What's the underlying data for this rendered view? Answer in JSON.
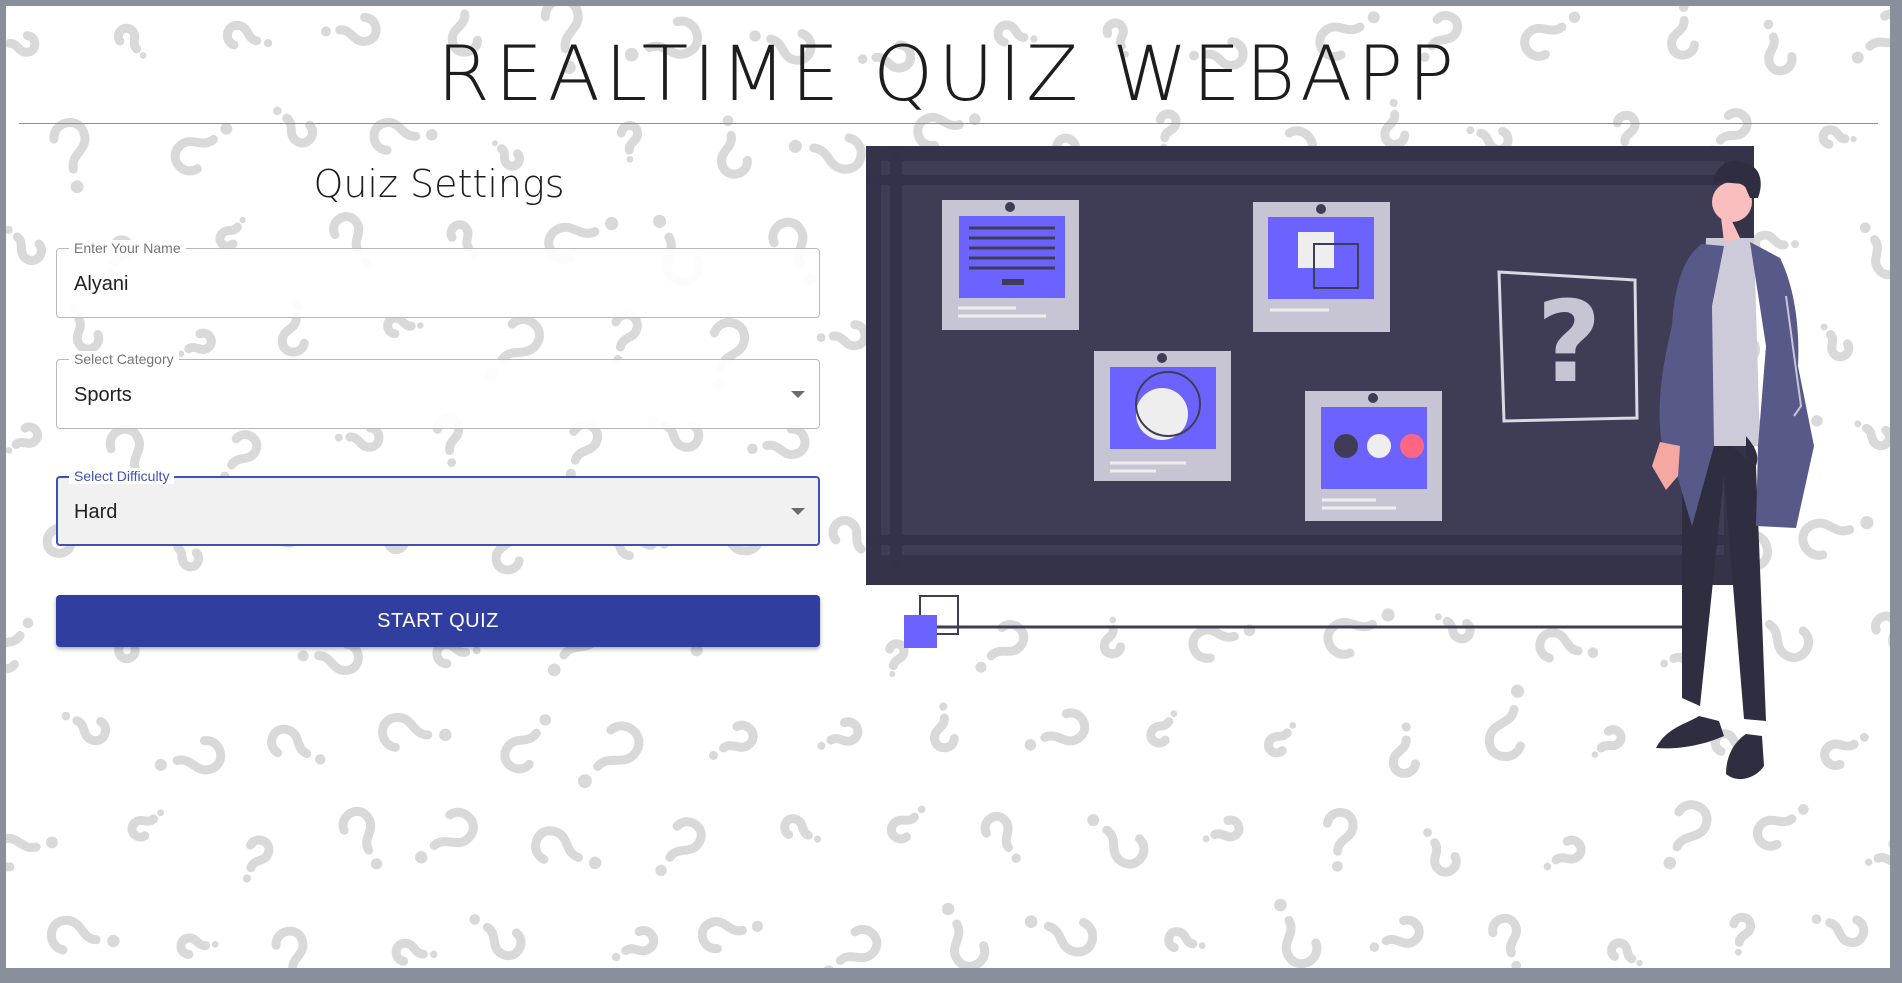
{
  "app": {
    "title": "REALTIME QUIZ WEBAPP"
  },
  "settings": {
    "title": "Quiz Settings",
    "name_field": {
      "label": "Enter Your Name",
      "value": "Alyani"
    },
    "category_field": {
      "label": "Select Category",
      "value": "Sports"
    },
    "difficulty_field": {
      "label": "Select Difficulty",
      "value": "Hard"
    },
    "start_button": "START QUIZ"
  },
  "illustration": {
    "board_sign": "?"
  },
  "colors": {
    "primary": "#303f9f",
    "focus": "#3f51b5",
    "board": "#3f3d56",
    "accent_purple": "#6c63ff",
    "accent_pink": "#ff6584"
  }
}
